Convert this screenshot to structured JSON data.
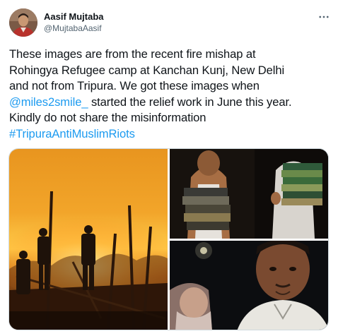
{
  "author": {
    "name": "Aasif Mujtaba",
    "handle": "@MujtabaAasif",
    "avatar_icon": "user-avatar"
  },
  "menu": {
    "icon": "more-horizontal-icon"
  },
  "tweet": {
    "line1": "These images are from the recent fire mishap at",
    "line2": "Rohingya Refugee camp at Kanchan Kunj, New Delhi",
    "line3": "and not from Tripura. We got these images when",
    "mention": "@miles2smile_",
    "line4_rest": " started the relief work in June this year.",
    "line5": "Kindly do not share the misinformation",
    "hashtag": "#TripuraAntiMuslimRiots"
  },
  "colors": {
    "link": "#1d9bf0",
    "text": "#0f1419",
    "secondary": "#536471",
    "border": "#cfd9de"
  },
  "media": {
    "count": 3
  }
}
